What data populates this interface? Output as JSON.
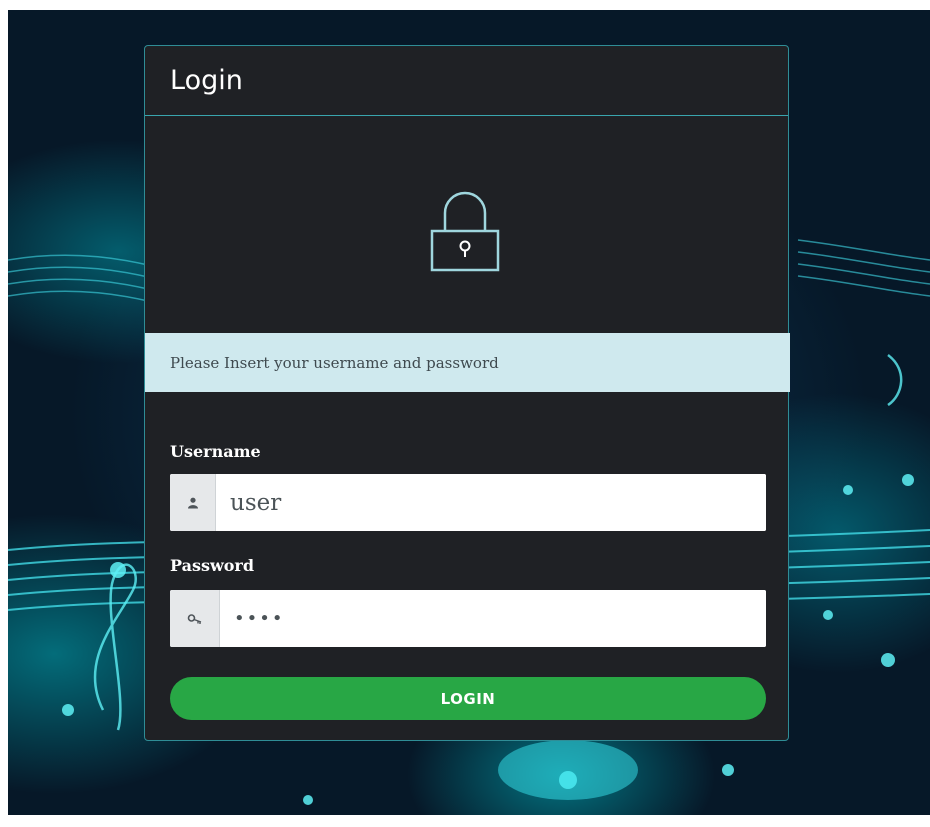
{
  "card": {
    "title": "Login",
    "message": "Please Insert your username and password"
  },
  "username": {
    "label": "Username",
    "value": "user",
    "icon": "user-icon"
  },
  "password": {
    "label": "Password",
    "value": "••••",
    "icon": "key-icon"
  },
  "login_button": {
    "label": "LOGIN"
  },
  "colors": {
    "card_bg": "#1f2125",
    "accent": "#39a5ae",
    "alert_bg": "#cfe9ee",
    "button": "#28a745",
    "background": "#0d3a5a"
  }
}
